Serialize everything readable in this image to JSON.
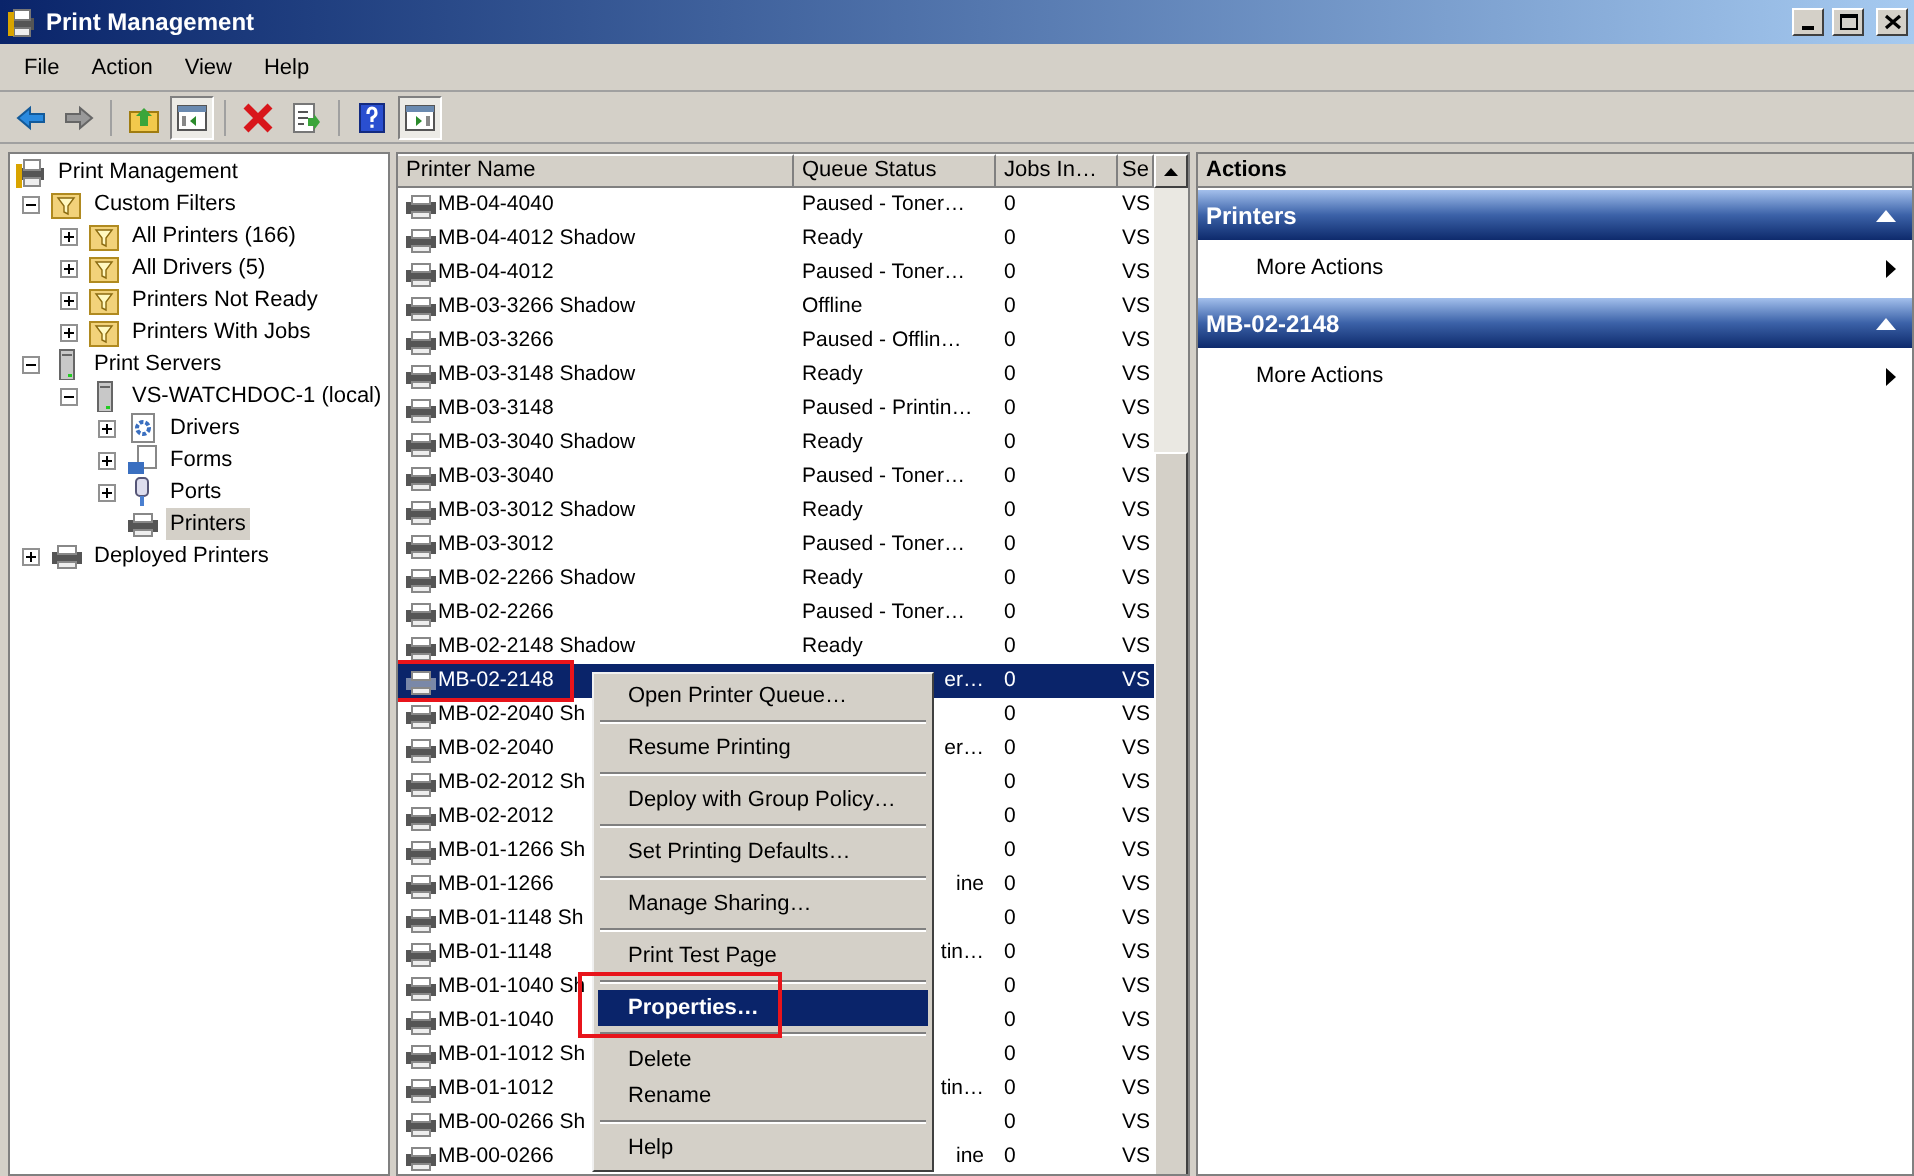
{
  "window": {
    "title": "Print Management"
  },
  "menu_bar": [
    "File",
    "Action",
    "View",
    "Help"
  ],
  "toolbar": [
    {
      "kind": "back",
      "pressed": false
    },
    {
      "kind": "forward",
      "pressed": false
    },
    {
      "kind": "up",
      "pressed": false
    },
    {
      "kind": "tree",
      "pressed": true
    },
    {
      "kind": "delete",
      "pressed": false
    },
    {
      "kind": "export",
      "pressed": false
    },
    {
      "kind": "help",
      "pressed": false
    },
    {
      "kind": "pane",
      "pressed": true
    }
  ],
  "tree": [
    {
      "label": "Print Management",
      "kind": "root",
      "selected": false,
      "children": [
        {
          "label": "Custom Filters",
          "kind": "filter",
          "expanded": true,
          "selected": false,
          "children": [
            {
              "label": "All Printers (166)",
              "kind": "filter",
              "expanded": false,
              "selected": false
            },
            {
              "label": "All Drivers (5)",
              "kind": "filter",
              "expanded": false,
              "selected": false
            },
            {
              "label": "Printers Not Ready",
              "kind": "filter",
              "expanded": false,
              "selected": false
            },
            {
              "label": "Printers With Jobs",
              "kind": "filter",
              "expanded": false,
              "selected": false
            }
          ]
        },
        {
          "label": "Print Servers",
          "kind": "server",
          "expanded": true,
          "selected": false,
          "children": [
            {
              "label": "VS-WATCHDOC-1 (local)",
              "kind": "server",
              "expanded": true,
              "selected": false,
              "children": [
                {
                  "label": "Drivers",
                  "kind": "drivers",
                  "expanded": false,
                  "selected": false
                },
                {
                  "label": "Forms",
                  "kind": "forms",
                  "expanded": false,
                  "selected": false
                },
                {
                  "label": "Ports",
                  "kind": "ports",
                  "expanded": false,
                  "selected": false
                },
                {
                  "label": "Printers",
                  "kind": "printer",
                  "selected": true
                }
              ]
            }
          ]
        },
        {
          "label": "Deployed Printers",
          "kind": "printer",
          "expanded": false,
          "selected": false
        }
      ]
    }
  ],
  "table": {
    "columns": [
      "Printer Name",
      "Queue Status",
      "Jobs In…",
      "Se"
    ],
    "rows": [
      {
        "name": "MB-04-4040",
        "status": "Paused - Toner…",
        "jobs": "0",
        "server": "VS",
        "selected": false,
        "kind": "full"
      },
      {
        "name": "MB-04-4012 Shadow",
        "status": "Ready",
        "jobs": "0",
        "server": "VS",
        "selected": false,
        "kind": "full"
      },
      {
        "name": "MB-04-4012",
        "status": "Paused - Toner…",
        "jobs": "0",
        "server": "VS",
        "selected": false,
        "kind": "full"
      },
      {
        "name": "MB-03-3266 Shadow",
        "status": "Offline",
        "jobs": "0",
        "server": "VS",
        "selected": false,
        "kind": "full"
      },
      {
        "name": "MB-03-3266",
        "status": "Paused - Offlin…",
        "jobs": "0",
        "server": "VS",
        "selected": false,
        "kind": "full"
      },
      {
        "name": "MB-03-3148 Shadow",
        "status": "Ready",
        "jobs": "0",
        "server": "VS",
        "selected": false,
        "kind": "full"
      },
      {
        "name": "MB-03-3148",
        "status": "Paused - Printin…",
        "jobs": "0",
        "server": "VS",
        "selected": false,
        "kind": "full"
      },
      {
        "name": "MB-03-3040 Shadow",
        "status": "Ready",
        "jobs": "0",
        "server": "VS",
        "selected": false,
        "kind": "full"
      },
      {
        "name": "MB-03-3040",
        "status": "Paused - Toner…",
        "jobs": "0",
        "server": "VS",
        "selected": false,
        "kind": "full"
      },
      {
        "name": "MB-03-3012 Shadow",
        "status": "Ready",
        "jobs": "0",
        "server": "VS",
        "selected": false,
        "kind": "full"
      },
      {
        "name": "MB-03-3012",
        "status": "Paused - Toner…",
        "jobs": "0",
        "server": "VS",
        "selected": false,
        "kind": "full"
      },
      {
        "name": "MB-02-2266 Shadow",
        "status": "Ready",
        "jobs": "0",
        "server": "VS",
        "selected": false,
        "kind": "full"
      },
      {
        "name": "MB-02-2266",
        "status": "Paused - Toner…",
        "jobs": "0",
        "server": "VS",
        "selected": false,
        "kind": "full"
      },
      {
        "name": "MB-02-2148 Shadow",
        "status": "Ready",
        "jobs": "0",
        "server": "VS",
        "selected": false,
        "kind": "full"
      },
      {
        "name": "MB-02-2148",
        "status": "er…",
        "jobs": "0",
        "server": "VS",
        "selected": true,
        "highlighted": true,
        "kind": "partial"
      },
      {
        "name": "MB-02-2040 Sh",
        "jobs": "0",
        "server": "VS",
        "selected": false,
        "kind": "partial"
      },
      {
        "name": "MB-02-2040",
        "status": "er…",
        "jobs": "0",
        "server": "VS",
        "selected": false,
        "kind": "partial"
      },
      {
        "name": "MB-02-2012 Sh",
        "jobs": "0",
        "server": "VS",
        "selected": false,
        "kind": "partial"
      },
      {
        "name": "MB-02-2012",
        "jobs": "0",
        "server": "VS",
        "selected": false,
        "kind": "partial"
      },
      {
        "name": "MB-01-1266 Sh",
        "jobs": "0",
        "server": "VS",
        "selected": false,
        "kind": "partial"
      },
      {
        "name": "MB-01-1266",
        "status": "ine",
        "jobs": "0",
        "server": "VS",
        "selected": false,
        "kind": "partial"
      },
      {
        "name": "MB-01-1148 Sh",
        "jobs": "0",
        "server": "VS",
        "selected": false,
        "kind": "partial"
      },
      {
        "name": "MB-01-1148",
        "status": "tin…",
        "jobs": "0",
        "server": "VS",
        "selected": false,
        "kind": "partial"
      },
      {
        "name": "MB-01-1040 Sh",
        "jobs": "0",
        "server": "VS",
        "selected": false,
        "kind": "partial"
      },
      {
        "name": "MB-01-1040",
        "jobs": "0",
        "server": "VS",
        "selected": false,
        "kind": "partial"
      },
      {
        "name": "MB-01-1012 Sh",
        "jobs": "0",
        "server": "VS",
        "selected": false,
        "kind": "partial"
      },
      {
        "name": "MB-01-1012",
        "status": "tin…",
        "jobs": "0",
        "server": "VS",
        "selected": false,
        "kind": "partial"
      },
      {
        "name": "MB-00-0266 Sh",
        "jobs": "0",
        "server": "VS",
        "selected": false,
        "kind": "partial"
      },
      {
        "name": "MB-00-0266",
        "status": "ine",
        "jobs": "0",
        "server": "VS",
        "selected": false,
        "kind": "partial"
      }
    ]
  },
  "context_menu": {
    "groups": [
      [
        {
          "label": "Open Printer Queue…",
          "selected": false
        }
      ],
      [
        {
          "label": "Resume Printing",
          "selected": false
        }
      ],
      [
        {
          "label": "Deploy with Group Policy…",
          "selected": false
        }
      ],
      [
        {
          "label": "Set Printing Defaults…",
          "selected": false
        }
      ],
      [
        {
          "label": "Manage Sharing…",
          "selected": false
        }
      ],
      [
        {
          "label": "Print Test Page",
          "selected": false
        }
      ],
      [
        {
          "label": "Properties…",
          "selected": true,
          "highlighted": true
        }
      ],
      [
        {
          "label": "Delete",
          "selected": false
        },
        {
          "label": "Rename",
          "selected": false
        }
      ],
      [
        {
          "label": "Help",
          "selected": false
        }
      ]
    ]
  },
  "actions": {
    "title": "Actions",
    "sections": [
      {
        "title": "Printers",
        "items": [
          "More Actions"
        ]
      },
      {
        "title": "MB-02-2148",
        "items": [
          "More Actions"
        ]
      }
    ]
  }
}
